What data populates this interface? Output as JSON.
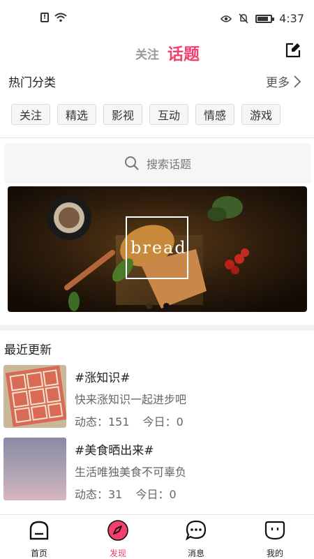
{
  "status_bar": {
    "time": "4:37"
  },
  "header": {
    "tab_follow": "关注",
    "tab_topic": "话题"
  },
  "hot": {
    "title": "热门分类",
    "more": "更多",
    "chips": [
      "关注",
      "精选",
      "影视",
      "互动",
      "情感",
      "游戏"
    ]
  },
  "search": {
    "placeholder": "搜索话题"
  },
  "banner": {
    "text": "bread",
    "dot_count": 2,
    "active_dot": 1
  },
  "recent": {
    "title": "最近更新",
    "items": [
      {
        "name": "#涨知识#",
        "desc": "快来涨知识一起进步吧",
        "dynamic": "动态：151",
        "today": "今日：0"
      },
      {
        "name": "#美食晒出来#",
        "desc": "生活唯独美食不可辜负",
        "dynamic": "动态：31",
        "today": "今日：0"
      }
    ]
  },
  "nav": {
    "items": [
      {
        "label": "首页",
        "icon": "home-icon"
      },
      {
        "label": "发现",
        "icon": "compass-icon"
      },
      {
        "label": "消息",
        "icon": "message-icon"
      },
      {
        "label": "我的",
        "icon": "profile-icon"
      }
    ],
    "active": "发现"
  },
  "colors": {
    "accent": "#f23f6d",
    "muted": "#999999"
  }
}
